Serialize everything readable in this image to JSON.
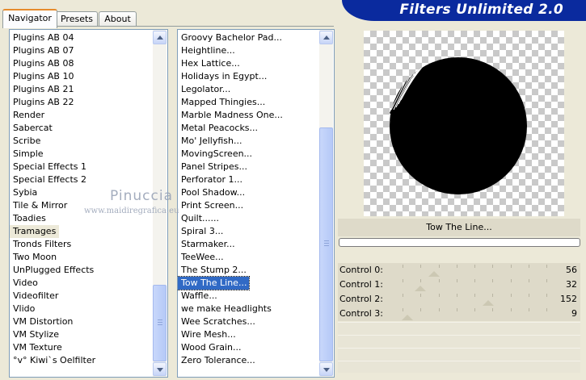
{
  "tabs": [
    {
      "label": "Navigator",
      "active": true
    },
    {
      "label": "Presets",
      "active": false
    },
    {
      "label": "About",
      "active": false
    }
  ],
  "banner": {
    "title": "Filters Unlimited 2.0",
    "color": "#0a2a9e"
  },
  "categories": {
    "items": [
      "Plugins AB 04",
      "Plugins AB 07",
      "Plugins AB 08",
      "Plugins AB 10",
      "Plugins AB 21",
      "Plugins AB 22",
      "Render",
      "Sabercat",
      "Scribe",
      "Simple",
      "Special Effects 1",
      "Special Effects 2",
      "Sybia",
      "Tile & Mirror",
      "Toadies",
      "Tramages",
      "Tronds Filters",
      "Two Moon",
      "UnPlugged Effects",
      "Video",
      "Videofilter",
      "Vlido",
      "VM Distortion",
      "VM Stylize",
      "VM Texture",
      "°v° Kiwi`s Oelfilter"
    ],
    "selected_index": 15
  },
  "filters": {
    "items": [
      "Groovy Bachelor Pad...",
      "Heightline...",
      "Hex Lattice...",
      "Holidays in Egypt...",
      "Legolator...",
      "Mapped Thingies...",
      "Marble Madness One...",
      "Metal Peacocks...",
      "Mo' Jellyfish...",
      "MovingScreen...",
      "Panel Stripes...",
      "Perforator 1...",
      "Pool Shadow...",
      "Print Screen...",
      "Quilt......",
      "Spiral 3...",
      "Starmaker...",
      "TeeWee...",
      "The Stump 2...",
      "Tow The Line...",
      "Waffle...",
      "we make Headlights",
      "Wee Scratches...",
      "Wire Mesh...",
      "Wood Grain...",
      "Zero Tolerance..."
    ],
    "selected_index": 19
  },
  "preview": {
    "filter_name": "Tow The Line...",
    "progress_percent": 0
  },
  "controls": [
    {
      "label": "Control 0:",
      "value": "56",
      "level": 56
    },
    {
      "label": "Control 1:",
      "value": "32",
      "level": 32
    },
    {
      "label": "Control 2:",
      "value": "152",
      "level": 152
    },
    {
      "label": "Control 3:",
      "value": "9",
      "level": 9
    }
  ],
  "watermark": {
    "name": "Pinuccia",
    "site": "www.maidiregrafica.eu"
  },
  "colors": {
    "selection": "#316ac5",
    "panel": "#dedac9",
    "background": "#ece9d8"
  }
}
